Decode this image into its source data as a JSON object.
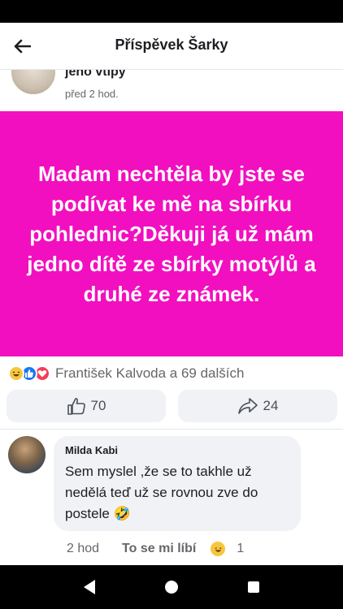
{
  "header": {
    "title": "Příspěvek Šarky"
  },
  "author": {
    "name": "jeho vtipy",
    "time": "před 2 hod."
  },
  "post": {
    "text": "Madam nechtěla by jste se podívat ke mě na sbírku pohlednic?Děkuji já už mám jedno dítě ze sbírky motýlů a druhé ze známek.",
    "background": "#f20fbf"
  },
  "reactions": {
    "icons": [
      "haha-icon",
      "like-icon",
      "love-icon"
    ],
    "summary": "František Kalvoda a 69 dalších"
  },
  "actions": {
    "like_count": "70",
    "share_count": "24"
  },
  "comment": {
    "author": "Milda Kabi",
    "text": "Sem myslel ,že se to takhle už nedělá teď už se rovnou zve do postele 🤣",
    "time": "2 hod",
    "like_label": "To se mi líbí",
    "reaction_count": "1"
  },
  "colors": {
    "accent_pink": "#f20fbf",
    "facebook_blue": "#1877f2",
    "muted_text": "#65676b"
  }
}
